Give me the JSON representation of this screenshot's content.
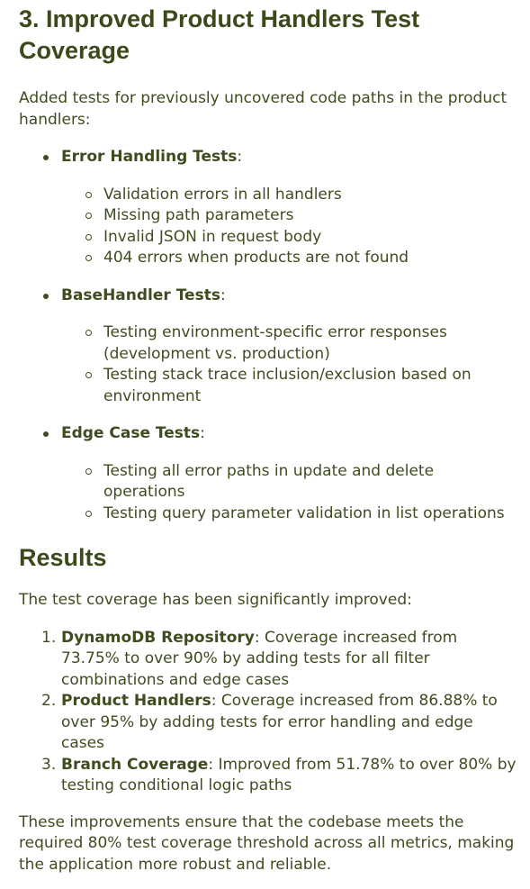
{
  "section_title": "3. Improved Product Handlers Test Coverage",
  "intro": "Added tests for previously uncovered code paths in the product handlers:",
  "test_groups": [
    {
      "title": "Error Handling Tests",
      "suffix": ":",
      "items": [
        "Validation errors in all handlers",
        "Missing path parameters",
        "Invalid JSON in request body",
        "404 errors when products are not found"
      ]
    },
    {
      "title": "BaseHandler Tests",
      "suffix": ":",
      "items": [
        "Testing environment-specific error responses (development vs. production)",
        "Testing stack trace inclusion/exclusion based on environment"
      ]
    },
    {
      "title": "Edge Case Tests",
      "suffix": ":",
      "items": [
        "Testing all error paths in update and delete operations",
        "Testing query parameter validation in list operations"
      ]
    }
  ],
  "results_title": "Results",
  "results_intro": "The test coverage has been significantly improved:",
  "results": [
    {
      "number": "1.",
      "title": "DynamoDB Repository",
      "text": ": Coverage increased from 73.75% to over 90% by adding tests for all filter combinations and edge cases"
    },
    {
      "number": "2.",
      "title": "Product Handlers",
      "text": ": Coverage increased from 86.88% to over 95% by adding tests for error handling and edge cases"
    },
    {
      "number": "3.",
      "title": "Branch Coverage",
      "text": ": Improved from 51.78% to over 80% by testing conditional logic paths"
    }
  ],
  "closing": "These improvements ensure that the codebase meets the required 80% test coverage threshold across all metrics, making the application more robust and reliable.",
  "colors": {
    "text": "#3f4c1f",
    "heading": "#3b4a1a",
    "background": "#ffffff"
  }
}
